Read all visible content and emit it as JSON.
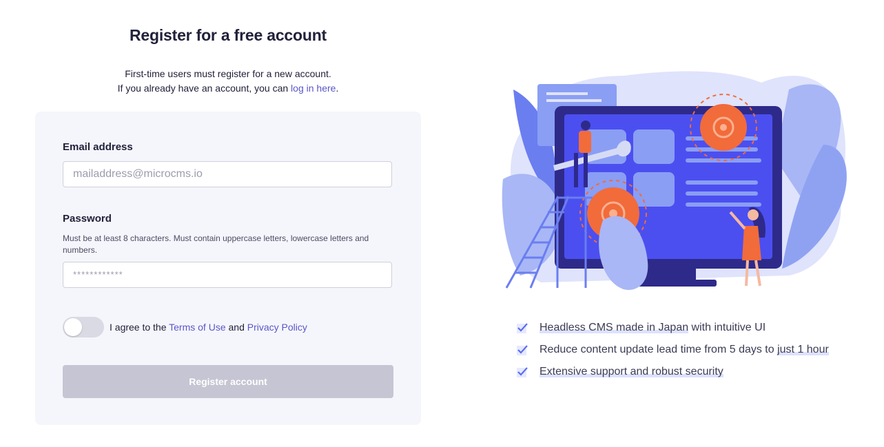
{
  "header": {
    "title": "Register for a free account",
    "intro_line1": "First-time users must register for a new account.",
    "intro_line2_prefix": "If you already have an account, you can ",
    "login_link": "log in here",
    "intro_line2_suffix": "."
  },
  "form": {
    "email_label": "Email address",
    "email_placeholder": "mailaddress@microcms.io",
    "email_value": "",
    "password_label": "Password",
    "password_hint": "Must be at least 8 characters. Must contain uppercase letters, lowercase letters and numbers.",
    "password_placeholder": "************",
    "password_value": "",
    "agree_prefix": "I agree to the ",
    "terms_link": "Terms of Use",
    "agree_and": " and ",
    "privacy_link": "Privacy Policy",
    "agree_checked": false,
    "submit_label": "Register account"
  },
  "features": [
    {
      "highlight": "Headless CMS made in Japan",
      "rest": " with intuitive UI",
      "icon": "check-icon"
    },
    {
      "prefix": "Reduce content update lead time from 5 days to ",
      "highlight": "just 1 hour",
      "icon": "check-icon"
    },
    {
      "highlight": "Extensive support and robust security",
      "icon": "check-icon"
    }
  ],
  "colors": {
    "accent": "#5a55c9",
    "button_disabled": "#c5c5d3",
    "card_bg": "#f5f6fb",
    "illustration_orange": "#f26b3a",
    "illustration_blue": "#4b4ff0"
  }
}
